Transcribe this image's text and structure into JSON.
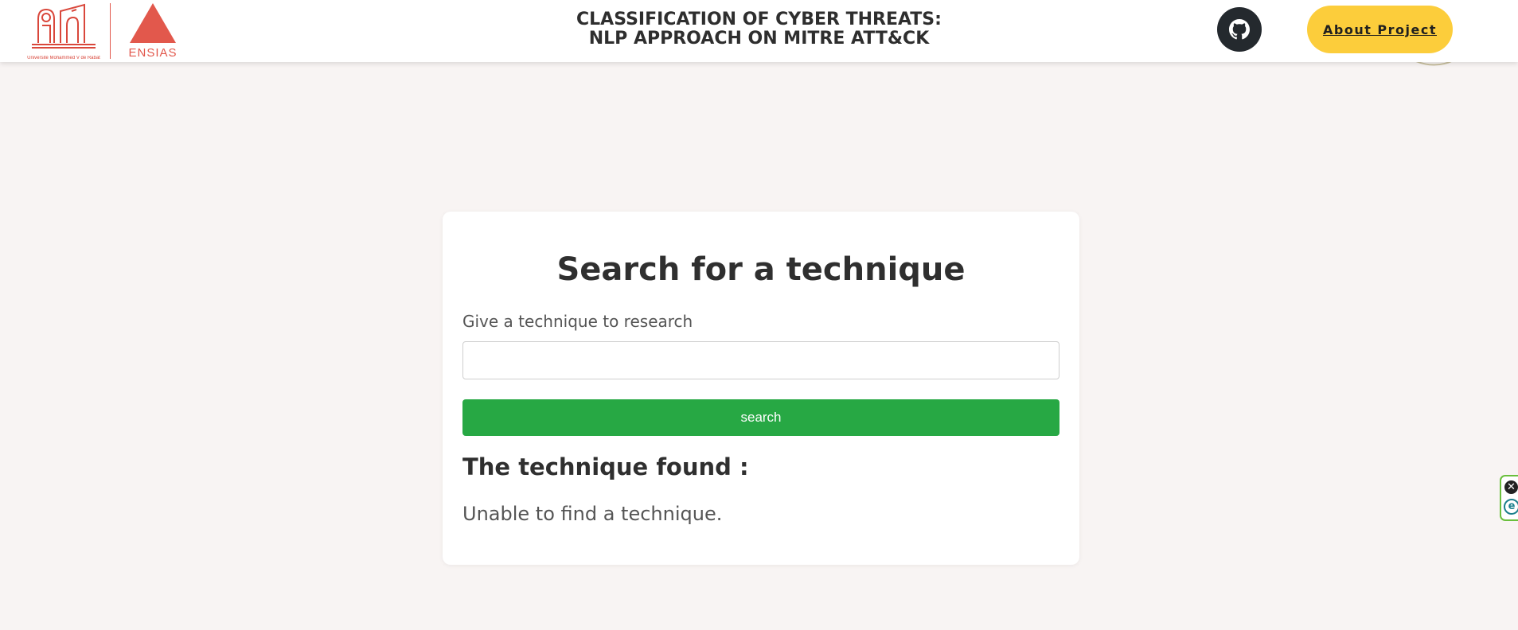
{
  "header": {
    "university_logo": {
      "icon": "university-mohammed-v-logo-icon",
      "caption": "Université Mohammed V de Rabat",
      "color": "#d9473b"
    },
    "school_logo": {
      "icon": "ensias-triangle-logo-icon",
      "text": "ENSIAS",
      "color": "#e2584c"
    },
    "title_line1": "CLASSIFICATION OF CYBER THREATS:",
    "title_line2": "NLP APPROACH ON MITRE ATT&CK",
    "github_icon": "github-icon",
    "about_label": "About Project",
    "about_color": "#fccd3b"
  },
  "search_card": {
    "title": "Search for a technique",
    "input_label": "Give a technique to research",
    "input_value": "",
    "button_label": "search",
    "button_color": "#27a844",
    "result_heading": "The technique found :",
    "result_text": "Unable to find a technique."
  },
  "extension_widget": {
    "close_icon": "close-icon",
    "e_icon": "e-extension-icon",
    "close_glyph": "✕",
    "e_glyph": "e"
  },
  "colors": {
    "page_background": "#f8f4f3",
    "card_background": "#ffffff",
    "text_dark": "#2f2f2f",
    "text_muted": "#555555"
  }
}
